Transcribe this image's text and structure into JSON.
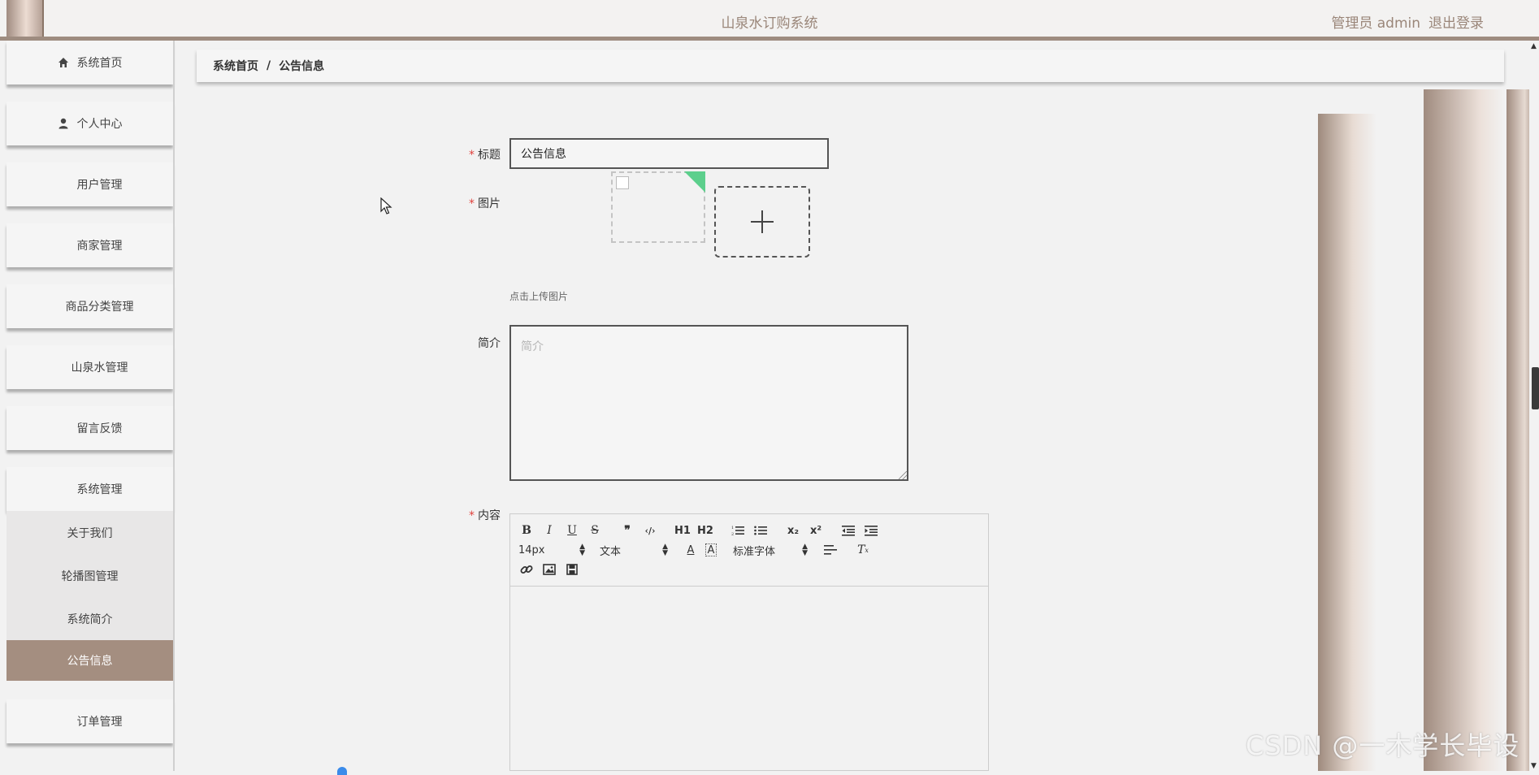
{
  "header": {
    "title": "山泉水订购系统",
    "role_user": "管理员 admin",
    "logout": "退出登录"
  },
  "sidebar": {
    "items": [
      {
        "label": "系统首页",
        "icon": "home-icon"
      },
      {
        "label": "个人中心",
        "icon": "user-icon"
      },
      {
        "label": "用户管理",
        "icon": "grid-icon"
      },
      {
        "label": "商家管理",
        "icon": "grid-icon"
      },
      {
        "label": "商品分类管理",
        "icon": "grid-icon"
      },
      {
        "label": "山泉水管理",
        "icon": "grid-icon"
      },
      {
        "label": "留言反馈",
        "icon": "grid-icon"
      },
      {
        "label": "系统管理",
        "icon": "grid-icon"
      }
    ],
    "sub_items": [
      {
        "label": "关于我们",
        "active": false
      },
      {
        "label": "轮播图管理",
        "active": false
      },
      {
        "label": "系统简介",
        "active": false
      },
      {
        "label": "公告信息",
        "active": true
      }
    ],
    "after_items": [
      {
        "label": "订单管理",
        "icon": "grid-icon"
      }
    ]
  },
  "breadcrumb": {
    "home": "系统首页",
    "separator": "/",
    "current": "公告信息"
  },
  "form": {
    "title_label": "标题",
    "title_value": "公告信息",
    "image_label": "图片",
    "upload_tip": "点击上传图片",
    "intro_label": "简介",
    "intro_placeholder": "简介",
    "content_label": "内容",
    "required_mark": "*"
  },
  "editor": {
    "row1": [
      "B",
      "I",
      "U",
      "S",
      "❞",
      "‹/›",
      "H1",
      "H2",
      "ol",
      "ul",
      "x₂",
      "x²",
      "outdent",
      "indent"
    ],
    "font_size": "14px",
    "text_style": "文本",
    "font_family": "标准字体"
  },
  "watermark": "CSDN @一木学长毕设",
  "colors": {
    "accent": "#a48e80",
    "required": "#e0413c",
    "tag_green": "#5ccf8c"
  }
}
